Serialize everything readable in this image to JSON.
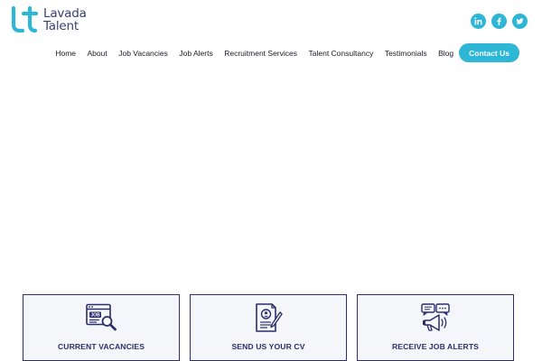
{
  "brand": {
    "name_line1": "Lavada",
    "name_line2": "Talent",
    "primary_color": "#3a3f75",
    "accent_color": "#2eb6d6"
  },
  "social": [
    {
      "label": "in",
      "icon": "linkedin-icon"
    },
    {
      "label": "f",
      "icon": "facebook-icon"
    },
    {
      "label": "",
      "icon": "twitter-icon"
    }
  ],
  "nav": {
    "items": [
      "Home",
      "About",
      "Job Vacancies",
      "Job Alerts",
      "Recruitment Services",
      "Talent Consultancy",
      "Testimonials",
      "Blog"
    ],
    "cta": "Contact Us"
  },
  "cards": [
    {
      "label": "CURRENT VACANCIES",
      "icon": "job-search-icon"
    },
    {
      "label": "SEND US YOUR CV",
      "icon": "cv-document-icon"
    },
    {
      "label": "RECEIVE JOB ALERTS",
      "icon": "megaphone-alerts-icon"
    }
  ]
}
